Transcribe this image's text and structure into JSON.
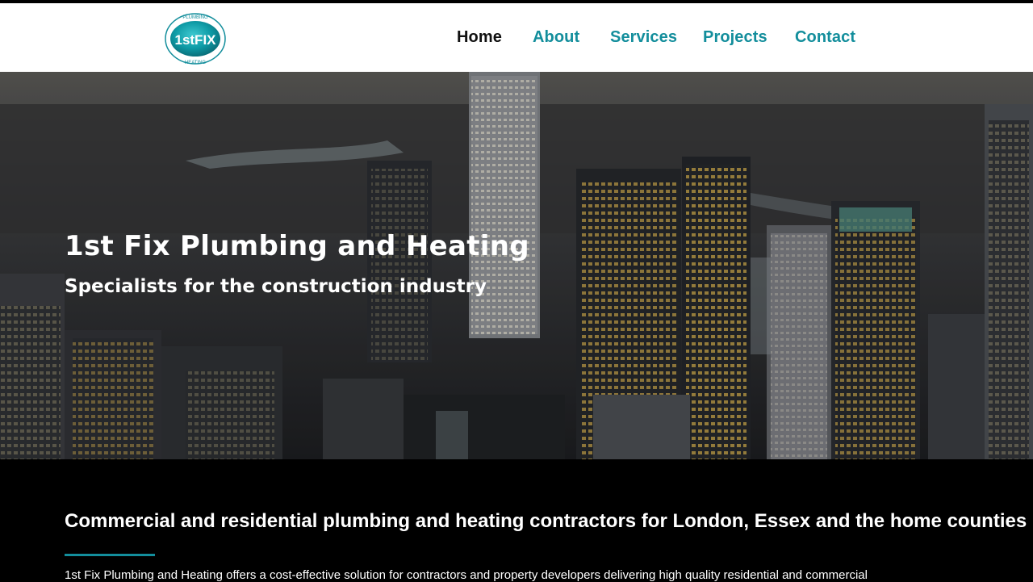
{
  "logo": {
    "main_text": "1stFIX",
    "top_text": "PLUMBING",
    "bottom_text": "HEATING"
  },
  "nav": {
    "items": [
      {
        "label": "Home",
        "active": true
      },
      {
        "label": "About",
        "active": false
      },
      {
        "label": "Services",
        "active": false
      },
      {
        "label": "Projects",
        "active": false
      },
      {
        "label": "Contact",
        "active": false
      }
    ]
  },
  "hero": {
    "title": "1st Fix Plumbing and Heating",
    "subtitle": "Specialists for the construction industry",
    "image": "city-skyline-at-dusk"
  },
  "intro": {
    "heading": "Commercial and residential plumbing and heating contractors for London, Essex and the home counties",
    "text": "1st Fix Plumbing and Heating offers a cost-effective solution for contractors and property developers delivering high quality residential and commercial"
  },
  "colors": {
    "accent": "#138e9c",
    "nav_active": "#111111",
    "header_bg": "#ffffff",
    "page_bg": "#000000"
  }
}
